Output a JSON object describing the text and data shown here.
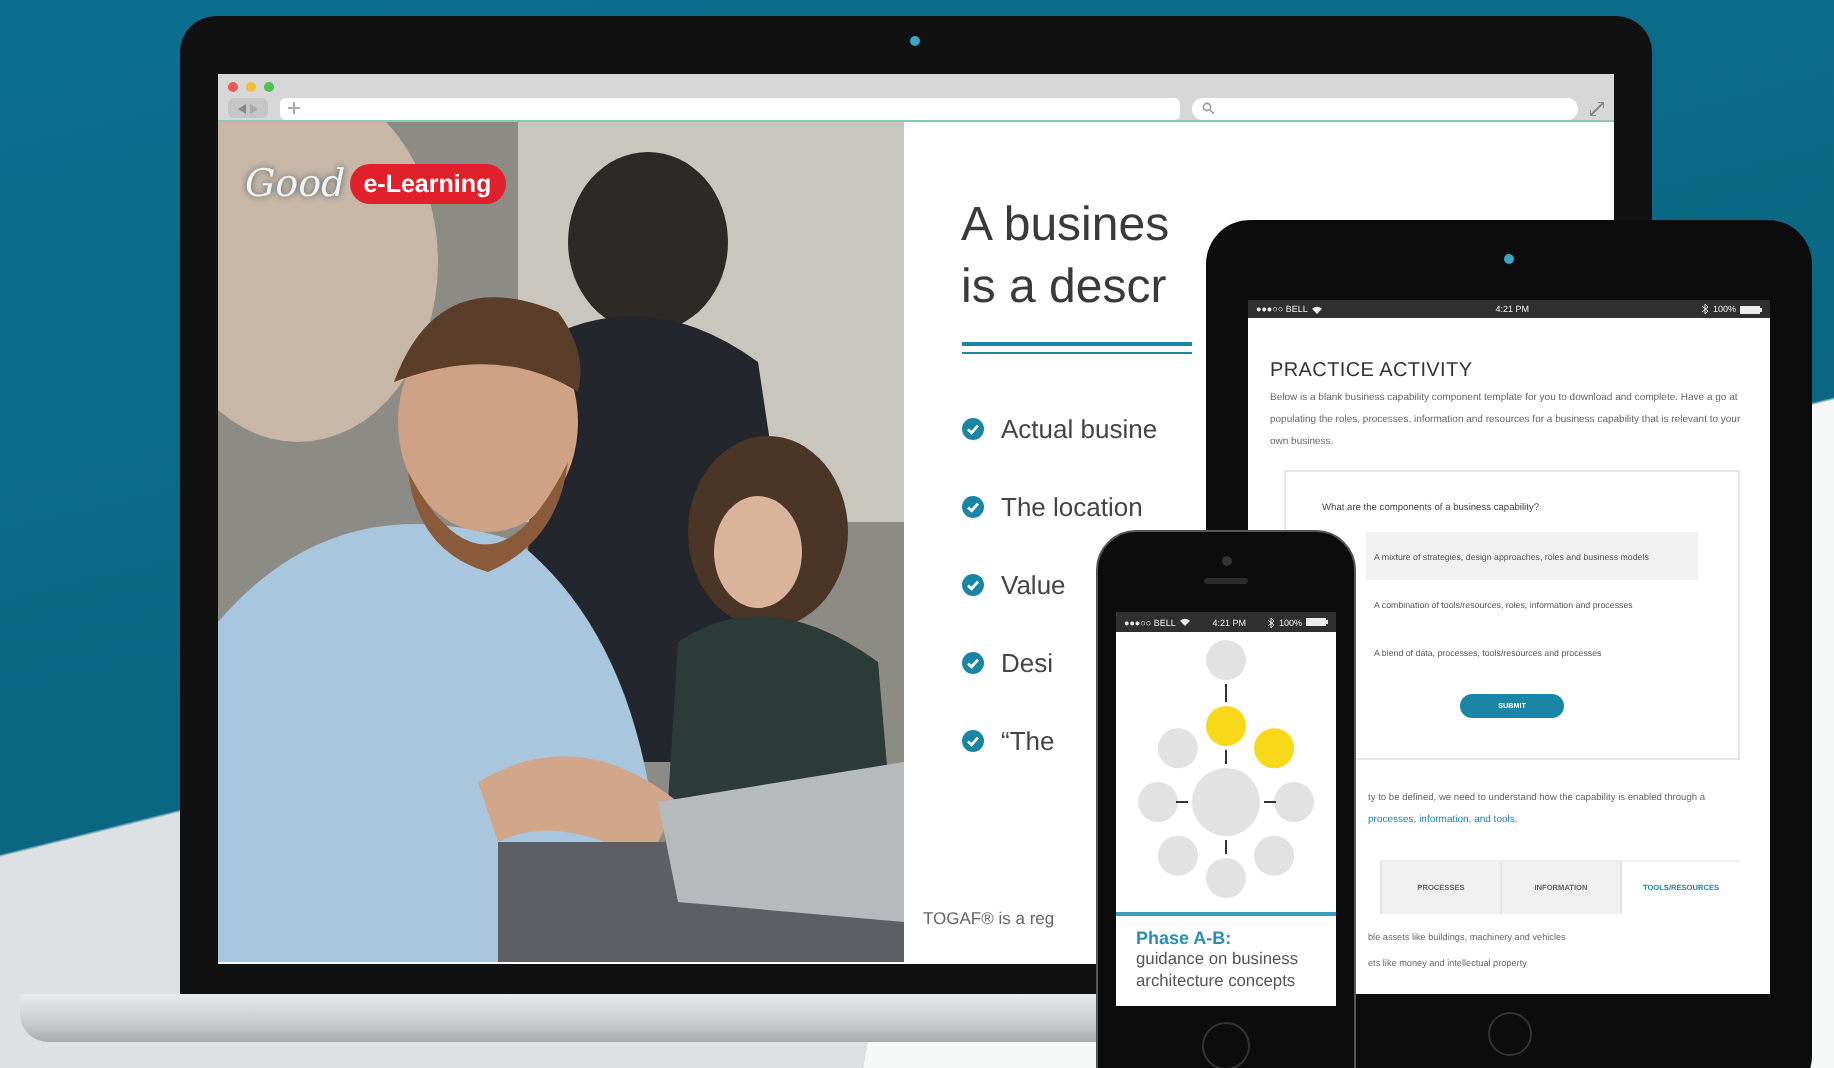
{
  "laptop": {
    "brand": {
      "word": "Good",
      "badge": "e-Learning"
    },
    "slide": {
      "title_lines": [
        "A busines",
        "is a descr"
      ],
      "bullets": [
        "Actual busine",
        "The location",
        "Value",
        "Desi",
        "“The"
      ],
      "footnote": "TOGAF® is a reg"
    }
  },
  "tablet": {
    "status_bar": {
      "carrier": "●●●○○ BELL",
      "time": "4:21 PM",
      "battery": "100%"
    },
    "activity": {
      "title": "PRACTICE ACTIVITY",
      "intro": "Below is a blank business capability component template for you to download and complete. Have a go at populating the roles, processes, information and resources for a business capability that is relevant to your own business.",
      "question": "What are the components of a business capability?",
      "options": [
        {
          "label": "A mixture of strategies, design approaches, roles and business models",
          "selected": true
        },
        {
          "label": "A combination of tools/resources, roles, information and processes",
          "selected": false
        },
        {
          "label": "A blend of data, processes, tools/resources and processes",
          "selected": false
        }
      ],
      "submit": "SUBMIT",
      "followup": "ty to be defined, we need to understand how the capability is enabled through a",
      "followup_link": "processes, information, and tools.",
      "tabs": [
        {
          "label": "PROCESSES",
          "selected": false
        },
        {
          "label": "INFORMATION",
          "selected": false
        },
        {
          "label": "TOOLS/RESOURCES",
          "selected": true
        }
      ],
      "tab_lines": [
        "ble assets like buildings, machinery and vehicles",
        "ets like money and intellectual property"
      ]
    }
  },
  "phone": {
    "status_bar": {
      "carrier": "●●●○○ BELL",
      "time": "4:21 PM",
      "battery": "100%"
    },
    "diagram": {
      "nodes": [
        {
          "highlighted": false
        },
        {
          "highlighted": true
        },
        {
          "highlighted": true
        },
        {
          "highlighted": false
        },
        {
          "highlighted": false
        },
        {
          "highlighted": false
        },
        {
          "highlighted": false
        },
        {
          "highlighted": false
        },
        {
          "highlighted": false
        },
        {
          "highlighted": false
        }
      ]
    },
    "caption_title": "Phase A-B:",
    "caption": "guidance on business architecture concepts"
  }
}
